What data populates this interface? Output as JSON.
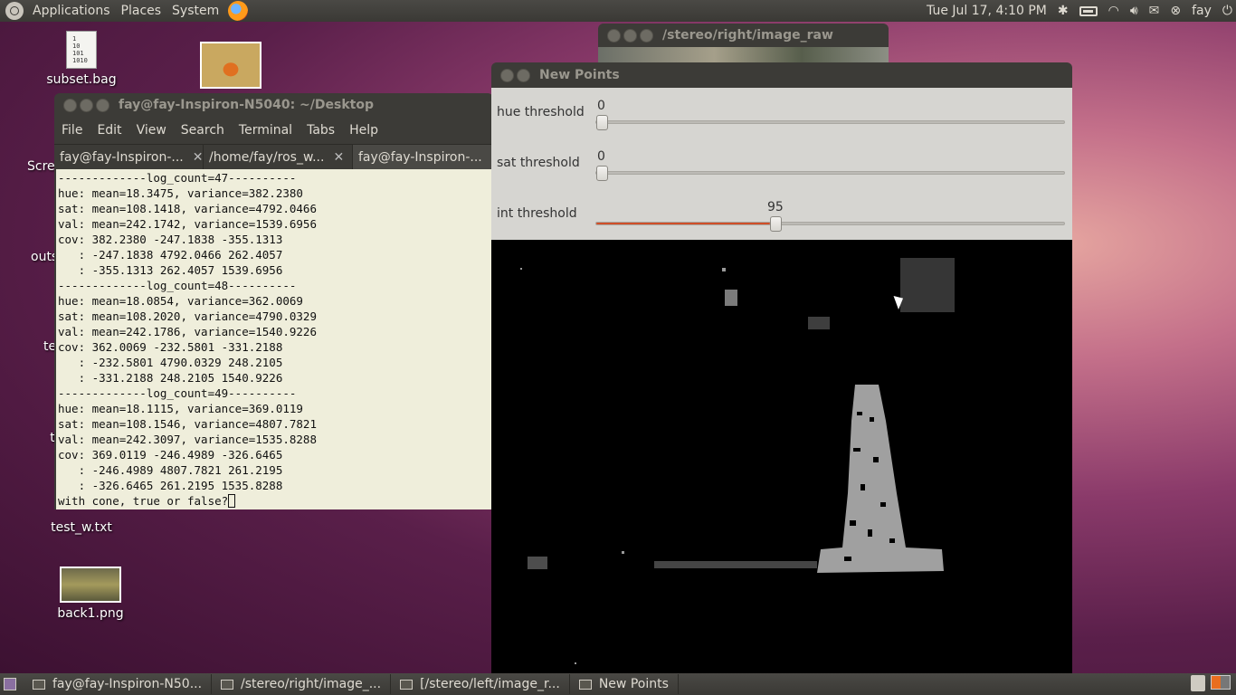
{
  "top_panel": {
    "menu": [
      "Applications",
      "Places",
      "System"
    ],
    "clock": "Tue Jul 17,  4:10 PM",
    "user": "fay"
  },
  "desktop_icons": {
    "subset": "subset.bag",
    "scre": "Scre",
    "outs": "outs",
    "te": "te",
    "t": "t",
    "test_w": "test_w.txt",
    "back1": "back1.png",
    "doc_text": "1\n10\n101\n1010"
  },
  "terminal": {
    "title": "fay@fay-Inspiron-N5040: ~/Desktop",
    "menu": [
      "File",
      "Edit",
      "View",
      "Search",
      "Terminal",
      "Tabs",
      "Help"
    ],
    "tabs": [
      "fay@fay-Inspiron-...",
      "/home/fay/ros_w...",
      "fay@fay-Inspiron-..."
    ],
    "lines": [
      "-------------log_count=47----------",
      "hue: mean=18.3475, variance=382.2380",
      "sat: mean=108.1418, variance=4792.0466",
      "val: mean=242.1742, variance=1539.6956",
      "cov: 382.2380 -247.1838 -355.1313",
      "   : -247.1838 4792.0466 262.4057",
      "   : -355.1313 262.4057 1539.6956",
      "-------------log_count=48----------",
      "hue: mean=18.0854, variance=362.0069",
      "sat: mean=108.2020, variance=4790.0329",
      "val: mean=242.1786, variance=1540.9226",
      "cov: 362.0069 -232.5801 -331.2188",
      "   : -232.5801 4790.0329 248.2105",
      "   : -331.2188 248.2105 1540.9226",
      "-------------log_count=49----------",
      "hue: mean=18.1115, variance=369.0119",
      "sat: mean=108.1546, variance=4807.7821",
      "val: mean=242.3097, variance=1535.8288",
      "cov: 369.0119 -246.4989 -326.6465",
      "   : -246.4989 4807.7821 261.2195",
      "   : -326.6465 261.2195 1535.8288"
    ],
    "prompt": "with cone, true or false?"
  },
  "stereo_right": {
    "title": "/stereo/right/image_raw"
  },
  "new_points": {
    "title": "New Points",
    "sliders": [
      {
        "label": "hue threshold",
        "value": "0",
        "fraction": 0.0
      },
      {
        "label": "sat threshold",
        "value": "0",
        "fraction": 0.0
      },
      {
        "label": "int threshold",
        "value": "95",
        "fraction": 0.37
      }
    ]
  },
  "taskbar": {
    "items": [
      "fay@fay-Inspiron-N50...",
      "/stereo/right/image_...",
      "[/stereo/left/image_r...",
      "New Points"
    ]
  },
  "colors": {
    "slider_fill": "#d04f28",
    "panel": "#3c3b37",
    "terminal_bg": "#efeedb"
  }
}
